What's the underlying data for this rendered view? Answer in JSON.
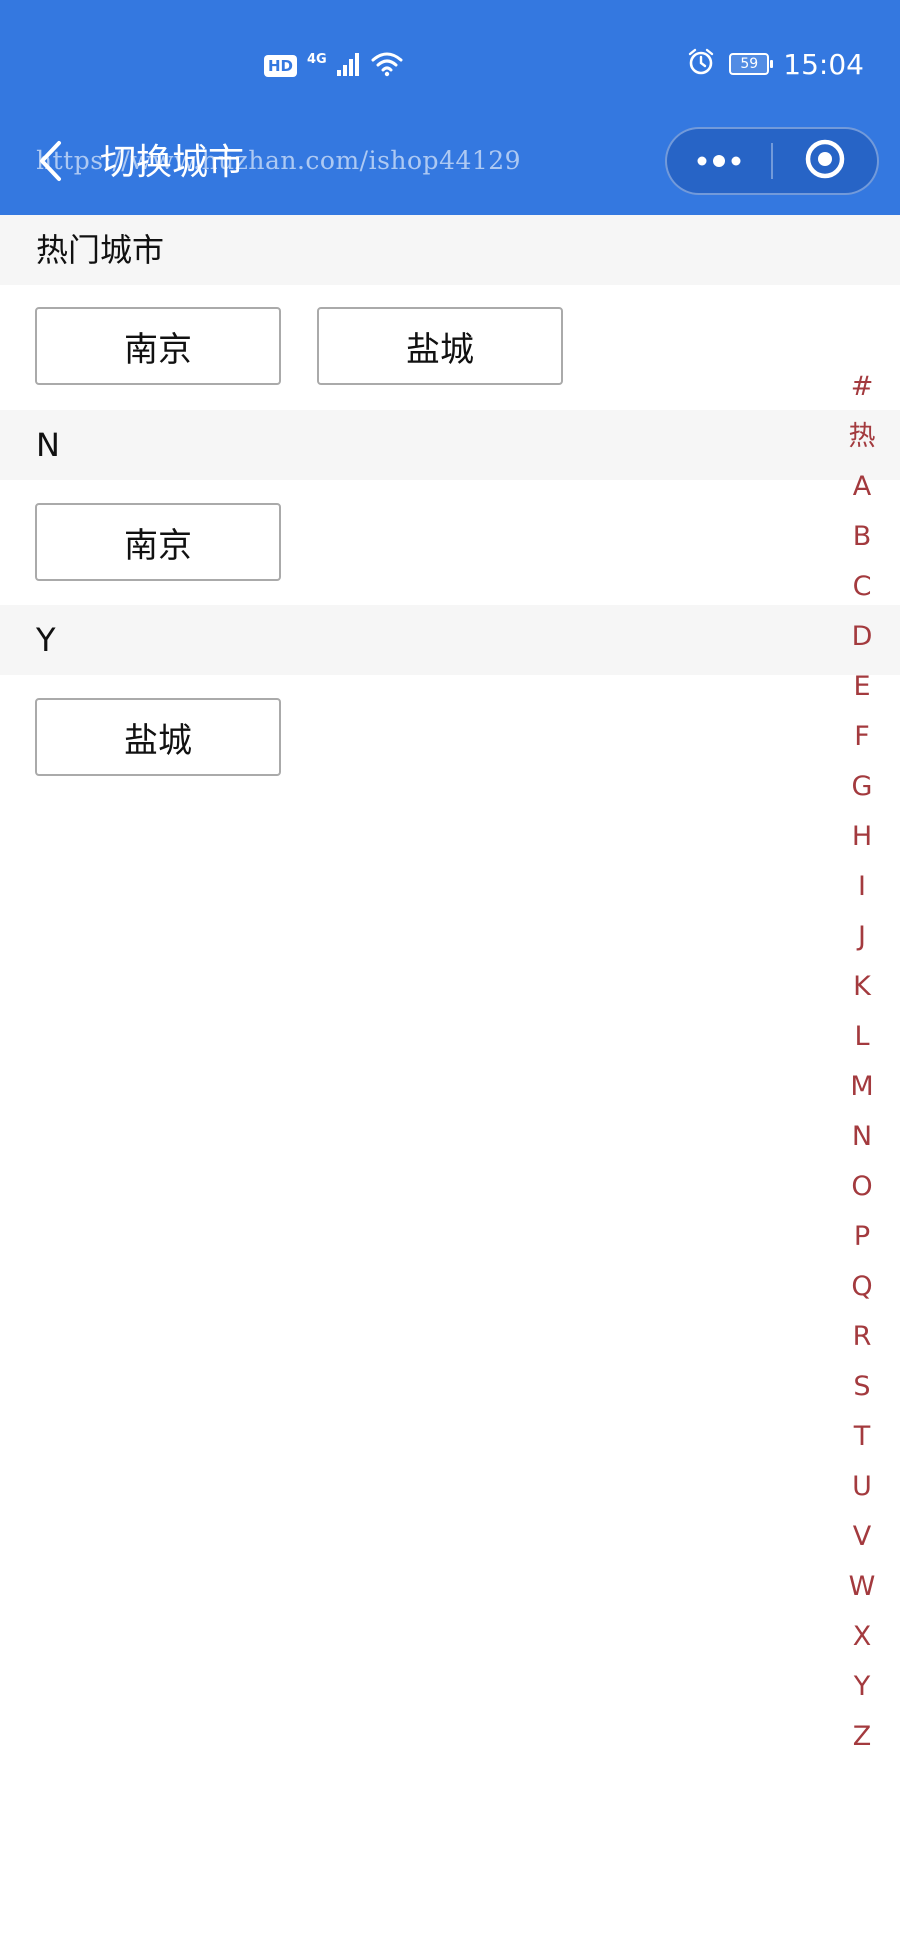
{
  "status_bar": {
    "hd": "HD",
    "network": "4G",
    "battery": "59",
    "time": "15:04"
  },
  "nav": {
    "title": "切换城市",
    "watermark": "https://www.huzhan.com/ishop44129",
    "icons": {
      "back": "chevron-left-icon",
      "more": "more-dots-icon",
      "close": "target-circle-icon"
    }
  },
  "hot": {
    "header": "热门城市",
    "cities": [
      "南京",
      "盐城"
    ]
  },
  "groups": [
    {
      "letter": "N",
      "cities": [
        "南京"
      ]
    },
    {
      "letter": "Y",
      "cities": [
        "盐城"
      ]
    }
  ],
  "index": [
    "#",
    "热",
    "A",
    "B",
    "C",
    "D",
    "E",
    "F",
    "G",
    "H",
    "I",
    "J",
    "K",
    "L",
    "M",
    "N",
    "O",
    "P",
    "Q",
    "R",
    "S",
    "T",
    "U",
    "V",
    "W",
    "X",
    "Y",
    "Z"
  ],
  "colors": {
    "nav_bg": "#3478e0",
    "index_text": "#a33a3e",
    "section_bg": "#f6f6f6"
  }
}
